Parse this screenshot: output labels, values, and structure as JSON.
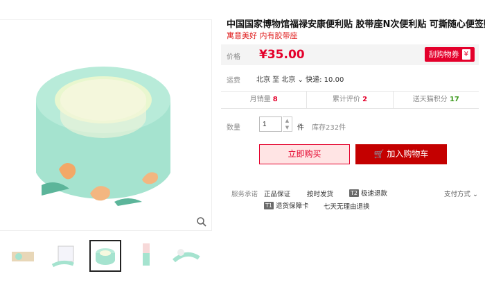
{
  "product": {
    "title": "中国国家博物馆福禄安康便利贴 胶带座N次便利贴 可撕随心便签贴",
    "subtitle": "寓意美好 内有胶带座"
  },
  "price": {
    "label": "价格",
    "value": "¥35.00",
    "coupon_label": "刮购物券",
    "coupon_symbol": "¥"
  },
  "shipping": {
    "label": "运费",
    "value": "北京 至 北京",
    "express": "快递: 10.00"
  },
  "stats": [
    {
      "label": "月销量",
      "value": "8",
      "color": "#e4002b"
    },
    {
      "label": "累计评价",
      "value": "2",
      "color": "#e4002b"
    },
    {
      "label": "送天猫积分",
      "value": "17",
      "color": "#3b9a1c"
    }
  ],
  "quantity": {
    "label": "数量",
    "value": "1",
    "unit": "件",
    "stock": "库存232件"
  },
  "buttons": {
    "buy_now": "立即购买",
    "add_cart": "加入购物车"
  },
  "services": {
    "label": "服务承诺",
    "items": [
      "正品保证",
      "按时发货",
      "极速退款",
      "退货保障卡",
      "七天无理由退换"
    ],
    "tags": [
      "T2",
      "T1"
    ],
    "payment": "支付方式"
  },
  "colors": {
    "accent": "#e4002b",
    "cart": "#c40000",
    "mint": "#a5e3cf"
  }
}
